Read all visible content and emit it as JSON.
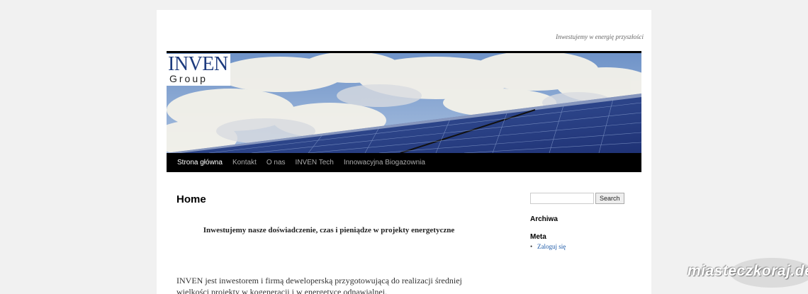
{
  "header": {
    "description": "Inwestujemy w energię przyszłości",
    "logo_line1": "INVEN",
    "logo_line2": "Group"
  },
  "nav": {
    "items": [
      {
        "label": "Strona główna",
        "current": true
      },
      {
        "label": "Kontakt"
      },
      {
        "label": "O nas"
      },
      {
        "label": "INVEN Tech"
      },
      {
        "label": "Innowacyjna Biogazownia"
      }
    ]
  },
  "main": {
    "title": "Home",
    "lead": "Inwestujemy nasze doświadczenie, czas i pieniądze w projekty energetyczne",
    "paragraph": "INVEN jest inwestorem i firmą deweloperską przygotowującą do realizacji średniej wielkości projekty w kogeneracji i w energetyce odnawialnej."
  },
  "sidebar": {
    "search_button": "Search",
    "archives_title": "Archiwa",
    "meta_title": "Meta",
    "meta_items": [
      "Zaloguj się"
    ]
  },
  "watermark": "miasteczkoraj.de",
  "colors": {
    "nav_bg": "#000000",
    "link": "#1d5aa8",
    "logo_blue": "#1d3b7e"
  }
}
